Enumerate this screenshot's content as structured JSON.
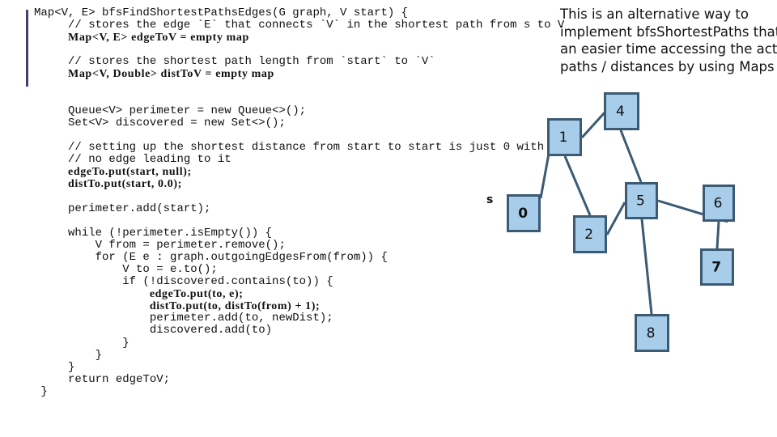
{
  "code": {
    "lines": [
      {
        "indent": 0,
        "text": "Map<V, E> bfsFindShortestPathsEdges(G graph, V start) {",
        "bold": false
      },
      {
        "indent": 5,
        "text": "// stores the edge `E` that connects `V` in the shortest path from s to V",
        "bold": false
      },
      {
        "indent": 5,
        "text": "Map<V, E> edgeToV = empty map",
        "bold": true
      },
      {
        "indent": 0,
        "text": "",
        "bold": false
      },
      {
        "indent": 5,
        "text": "// stores the shortest path length from `start` to `V`",
        "bold": false
      },
      {
        "indent": 5,
        "text": "Map<V, Double> distToV = empty map",
        "bold": true
      },
      {
        "indent": 0,
        "text": "",
        "bold": false
      },
      {
        "indent": 0,
        "text": "",
        "bold": false
      },
      {
        "indent": 5,
        "text": "Queue<V> perimeter = new Queue<>();",
        "bold": false
      },
      {
        "indent": 5,
        "text": "Set<V> discovered = new Set<>();",
        "bold": false
      },
      {
        "indent": 0,
        "text": "",
        "bold": false
      },
      {
        "indent": 5,
        "text": "// setting up the shortest distance from start to start is just 0 with",
        "bold": false
      },
      {
        "indent": 5,
        "text": "// no edge leading to it",
        "bold": false
      },
      {
        "indent": 5,
        "text": "edgeTo.put(start, null);",
        "bold": true
      },
      {
        "indent": 5,
        "text": "distTo.put(start, 0.0);",
        "bold": true
      },
      {
        "indent": 0,
        "text": "",
        "bold": false
      },
      {
        "indent": 5,
        "text": "perimeter.add(start);",
        "bold": false
      },
      {
        "indent": 0,
        "text": "",
        "bold": false
      },
      {
        "indent": 5,
        "text": "while (!perimeter.isEmpty()) {",
        "bold": false
      },
      {
        "indent": 9,
        "text": "V from = perimeter.remove();",
        "bold": false
      },
      {
        "indent": 9,
        "text": "for (E e : graph.outgoingEdgesFrom(from)) {",
        "bold": false
      },
      {
        "indent": 13,
        "text": "V to = e.to();",
        "bold": false
      },
      {
        "indent": 13,
        "text": "if (!discovered.contains(to)) {",
        "bold": false
      },
      {
        "indent": 17,
        "text": "edgeTo.put(to, e);",
        "bold": true
      },
      {
        "indent": 17,
        "text": "distTo.put(to, distTo(from) + 1);",
        "bold": true
      },
      {
        "indent": 17,
        "text": "perimeter.add(to, newDist);",
        "bold": false
      },
      {
        "indent": 17,
        "text": "discovered.add(to)",
        "bold": false
      },
      {
        "indent": 13,
        "text": "}",
        "bold": false
      },
      {
        "indent": 9,
        "text": "}",
        "bold": false
      },
      {
        "indent": 5,
        "text": "}",
        "bold": false
      },
      {
        "indent": 5,
        "text": "return edgeToV;",
        "bold": false
      },
      {
        "indent": 1,
        "text": "}",
        "bold": false
      }
    ]
  },
  "note": {
    "lines": [
      "This is an alternative way to",
      "implement bfsShortestPaths that has",
      "an easier time accessing the actual",
      "paths / distances by using Maps"
    ]
  },
  "graph": {
    "start_label": "s",
    "start_node": "0",
    "colors": {
      "node_fill": "#a7cdea",
      "node_stroke": "#3b5a73",
      "edge": "#3b5a73",
      "text": "#111111"
    },
    "nodes": [
      {
        "id": "0",
        "label": "0",
        "bold_label": true
      },
      {
        "id": "1",
        "label": "1",
        "bold_label": false
      },
      {
        "id": "2",
        "label": "2",
        "bold_label": false
      },
      {
        "id": "4",
        "label": "4",
        "bold_label": false
      },
      {
        "id": "5",
        "label": "5",
        "bold_label": false
      },
      {
        "id": "6",
        "label": "6",
        "bold_label": false
      },
      {
        "id": "7",
        "label": "7",
        "bold_label": true
      },
      {
        "id": "8",
        "label": "8",
        "bold_label": false
      }
    ],
    "edges": [
      [
        "0",
        "1"
      ],
      [
        "1",
        "4"
      ],
      [
        "1",
        "2"
      ],
      [
        "4",
        "5"
      ],
      [
        "2",
        "5"
      ],
      [
        "5",
        "6"
      ],
      [
        "5",
        "8"
      ],
      [
        "6",
        "7"
      ]
    ]
  }
}
